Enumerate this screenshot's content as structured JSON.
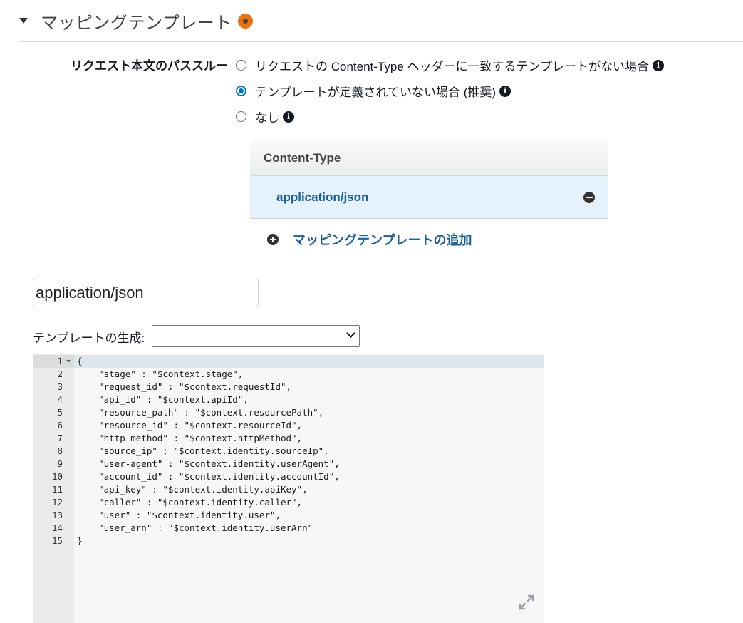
{
  "section": {
    "title": "マッピングテンプレート"
  },
  "passthrough": {
    "label": "リクエスト本文のパススルー",
    "options": [
      {
        "label": "リクエストの Content-Type ヘッダーに一致するテンプレートがない場合",
        "checked": false
      },
      {
        "label": "テンプレートが定義されていない場合 (推奨)",
        "checked": true
      },
      {
        "label": "なし",
        "checked": false
      }
    ]
  },
  "content_type_table": {
    "header": "Content-Type",
    "rows": [
      {
        "value": "application/json"
      }
    ],
    "add_label": "マッピングテンプレートの追加"
  },
  "content_type_input": {
    "value": "application/json"
  },
  "generate_template": {
    "label": "テンプレートの生成:",
    "selected": ""
  },
  "editor": {
    "lines": [
      "{",
      "    \"stage\" : \"$context.stage\",",
      "    \"request_id\" : \"$context.requestId\",",
      "    \"api_id\" : \"$context.apiId\",",
      "    \"resource_path\" : \"$context.resourcePath\",",
      "    \"resource_id\" : \"$context.resourceId\",",
      "    \"http_method\" : \"$context.httpMethod\",",
      "    \"source_ip\" : \"$context.identity.sourceIp\",",
      "    \"user-agent\" : \"$context.identity.userAgent\",",
      "    \"account_id\" : \"$context.identity.accountId\",",
      "    \"api_key\" : \"$context.identity.apiKey\",",
      "    \"caller\" : \"$context.identity.caller\",",
      "    \"user\" : \"$context.identity.user\",",
      "    \"user_arn\" : \"$context.identity.userArn\"",
      "}"
    ]
  },
  "colors": {
    "accent": "#0073bb",
    "link": "#1a5fa0",
    "status": "#ec7211",
    "selected_row": "#e6f2fb"
  },
  "icons": {
    "caret": "caret-down-icon",
    "status": "status-dot-icon",
    "info": "info-icon",
    "remove": "minus-circle-icon",
    "add": "plus-circle-icon",
    "expand": "expand-icon"
  }
}
